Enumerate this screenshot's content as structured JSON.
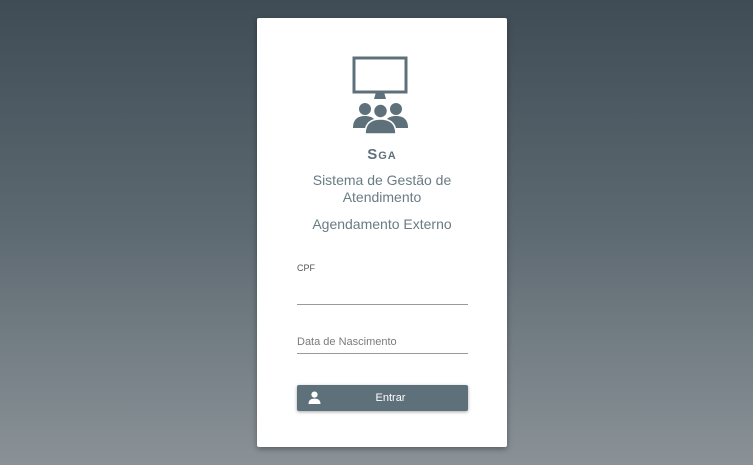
{
  "app": {
    "brand": "Sga",
    "system_name": "Sistema de Gestão de Atendimento",
    "subtitle": "Agendamento Externo"
  },
  "form": {
    "cpf": {
      "label": "CPF",
      "value": ""
    },
    "birth_date": {
      "placeholder": "Data de Nascimento",
      "value": ""
    },
    "submit": {
      "label": "Entrar",
      "icon": "user-icon"
    }
  },
  "icons": {
    "logo": "monitor-group-icon"
  },
  "colors": {
    "accent": "#5e717b",
    "card_background": "#ffffff",
    "text_muted": "#6a7b84"
  }
}
